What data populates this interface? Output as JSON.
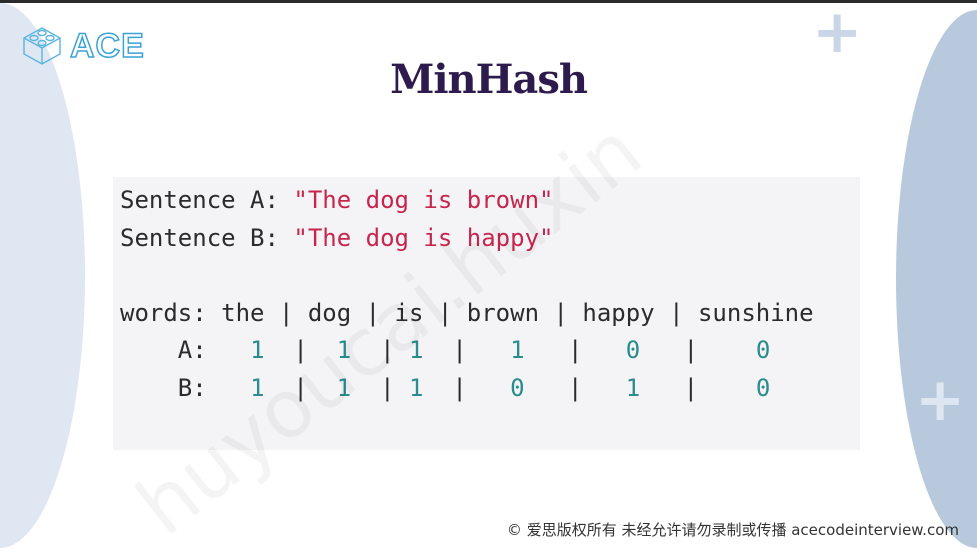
{
  "logo": {
    "text": "ACE"
  },
  "title": "MinHash",
  "code": {
    "sentence_a_label": "Sentence A: ",
    "sentence_a": "\"The dog is brown\"",
    "sentence_b_label": "Sentence B: ",
    "sentence_b": "\"The dog is happy\"",
    "words_line": "words: the | dog | is | brown | happy | sunshine",
    "rows": [
      {
        "label": "A:",
        "values": [
          "1",
          "1",
          "1",
          "1",
          "0",
          "0"
        ]
      },
      {
        "label": "B:",
        "values": [
          "1",
          "1",
          "1",
          "0",
          "1",
          "0"
        ]
      }
    ]
  },
  "watermark": "huyoucai.huxin",
  "footer": "© 爱思版权所有 未经允许请勿录制或传播 acecodeinterview.com",
  "colors": {
    "title": "#2d1b4e",
    "string": "#c7254e",
    "number": "#2a8c8c",
    "code_bg": "#f4f4f6"
  }
}
